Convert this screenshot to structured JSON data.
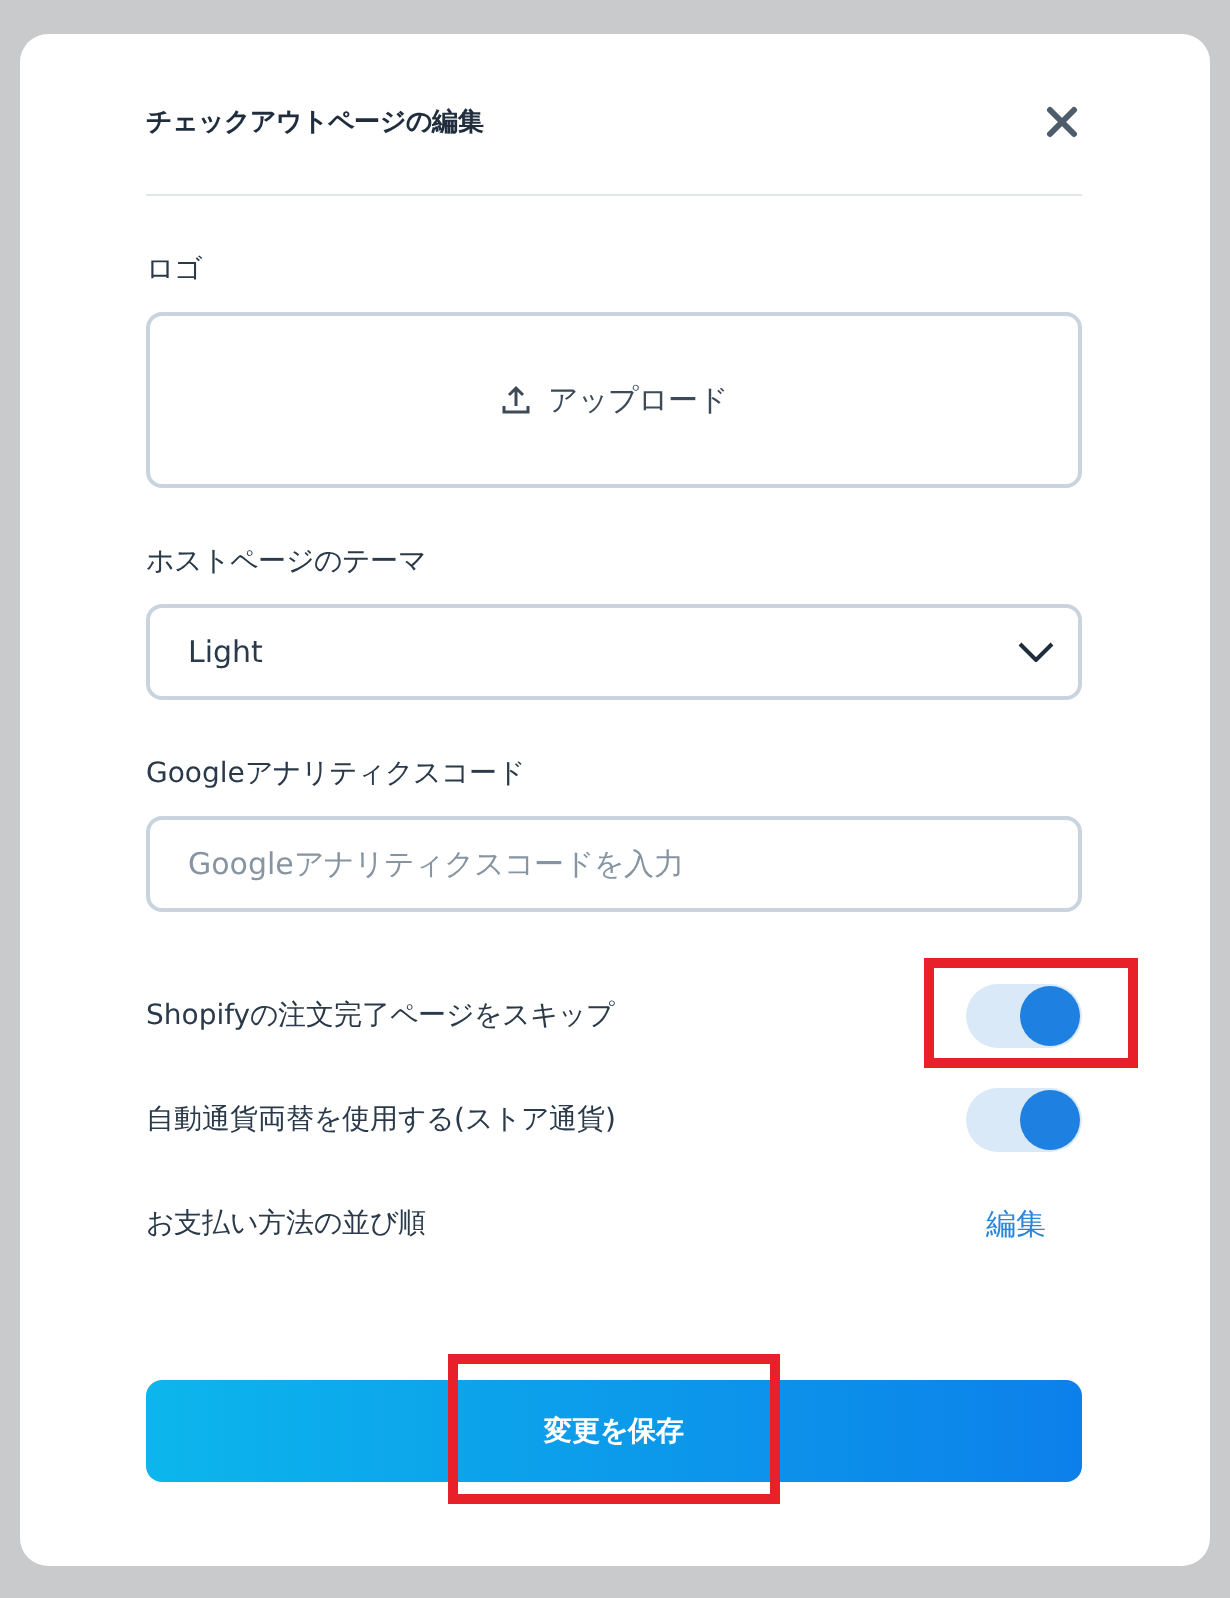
{
  "dialog": {
    "title": "チェックアウトページの編集"
  },
  "logo": {
    "label": "ロゴ",
    "upload_label": "アップロード"
  },
  "theme": {
    "label": "ホストページのテーマ",
    "value": "Light"
  },
  "analytics": {
    "label": "Googleアナリティクスコード",
    "placeholder": "Googleアナリティクスコードを入力"
  },
  "toggles": [
    {
      "label": "Shopifyの注文完了ページをスキップ",
      "on": true,
      "highlighted": true
    },
    {
      "label": "自動通貨両替を使用する(ストア通貨)",
      "on": true,
      "highlighted": false
    }
  ],
  "payment_order": {
    "label": "お支払い方法の並び順",
    "action": "編集"
  },
  "save": {
    "label": "変更を保存",
    "highlighted": true
  }
}
